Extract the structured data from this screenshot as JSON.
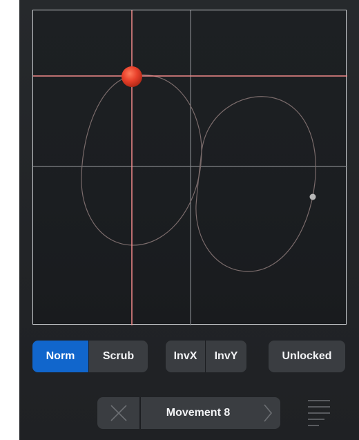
{
  "pad": {
    "handle_color": "#e8402a",
    "crosshair_color": "#f28a8a",
    "grid_color": "#8a8d91",
    "path_color": "#7a6b6b"
  },
  "mode": {
    "norm_label": "Norm",
    "scrub_label": "Scrub",
    "selected": "Norm"
  },
  "invert": {
    "invx_label": "InvX",
    "invy_label": "InvY"
  },
  "lock": {
    "label": "Unlocked"
  },
  "movement": {
    "title": "Movement 8",
    "clear_icon": "close-icon",
    "next_icon": "chevron-right-icon"
  },
  "menu": {
    "icon": "hamburger-menu-icon"
  },
  "colors": {
    "accent": "#1166cc",
    "button_bg": "#3a3d41",
    "panel_bg": "#222427"
  }
}
